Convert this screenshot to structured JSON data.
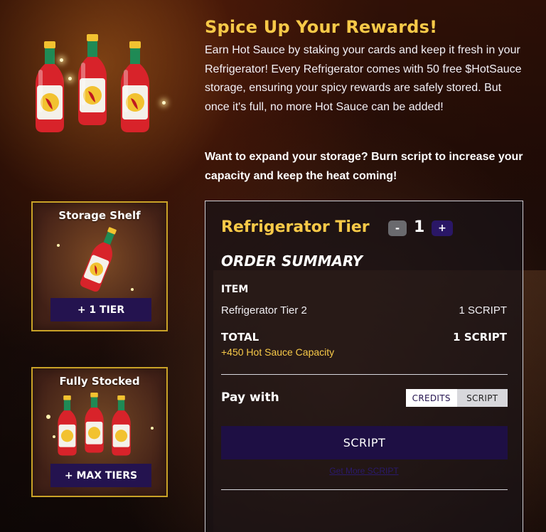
{
  "header": {
    "title": "Spice Up Your Rewards!",
    "intro": "Earn Hot Sauce by staking your cards and keep it fresh in your Refrigerator! Every Refrigerator comes with 50 free $HotSauce storage, ensuring your spicy rewards are safely stored. But once it's full, no more Hot Sauce can be added!",
    "intro_bold": "Want to expand your storage? Burn script to increase your capacity and keep the heat coming!"
  },
  "tiers": [
    {
      "title": "Storage Shelf",
      "button_label": "+ 1 TIER",
      "icon": "hot-sauce-bottle-icon"
    },
    {
      "title": "Fully Stocked",
      "button_label": "+ MAX TIERS",
      "icon": "hot-sauce-bottles-icon"
    }
  ],
  "order": {
    "tier_label": "Refrigerator Tier",
    "minus_label": "-",
    "quantity": "1",
    "plus_label": "+",
    "summary_title": "ORDER SUMMARY",
    "item_header": "ITEM",
    "item_name": "Refrigerator Tier 2",
    "item_price": "1 SCRIPT",
    "total_label": "TOTAL",
    "total_price": "1 SCRIPT",
    "capacity_note": "+450 Hot Sauce Capacity",
    "pay_with_label": "Pay with",
    "pay_options": [
      "CREDITS",
      "SCRIPT"
    ],
    "buy_button": "SCRIPT",
    "get_more_link": "Get More SCRIPT"
  },
  "colors": {
    "accent_gold": "#f7c948",
    "button_purple": "#24134f",
    "bottle_red": "#d8232a",
    "bottle_green": "#1f8a55"
  }
}
